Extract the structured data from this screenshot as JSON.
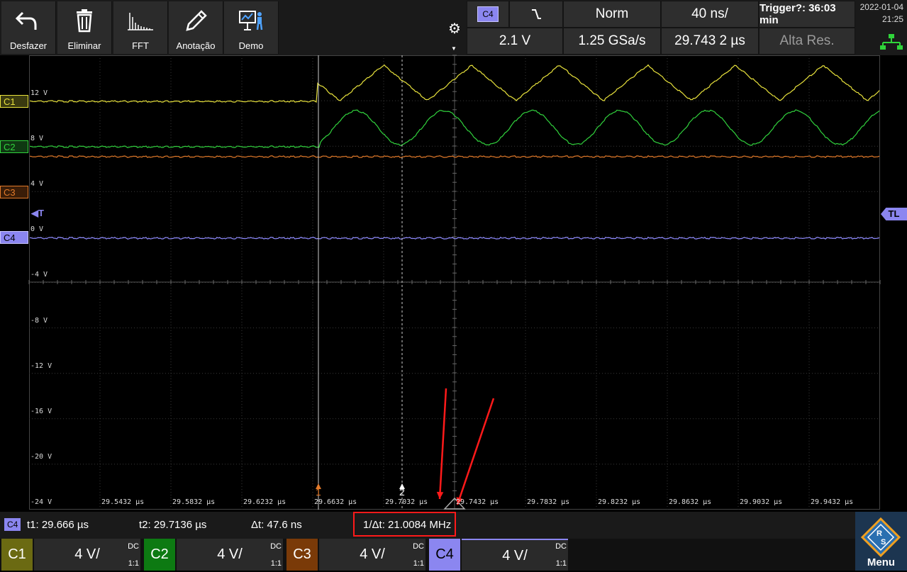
{
  "toolbar": {
    "buttons": [
      {
        "label": "Desfazer",
        "icon": "undo-icon"
      },
      {
        "label": "Eliminar",
        "icon": "trash-icon"
      },
      {
        "label": "FFT",
        "icon": "fft-icon"
      },
      {
        "label": "Anotação",
        "icon": "pencil-icon"
      },
      {
        "label": "Demo",
        "icon": "demo-icon"
      }
    ]
  },
  "trigger": {
    "source": "C4",
    "slope": "falling",
    "mode": "Norm",
    "timebase": "40 ns/",
    "status": "Trigger?: 36:03 min",
    "level": "2.1 V",
    "sample_rate": "1.25 GSa/s",
    "position": "29.743 2 µs",
    "acq_mode": "Alta Res."
  },
  "datetime": {
    "date": "2022-01-04",
    "time": "21:25"
  },
  "graticule": {
    "volt_labels": [
      "12 V",
      "8 V",
      "4 V",
      "0 V",
      "-4 V",
      "-8 V",
      "-12 V",
      "-16 V",
      "-20 V",
      "-24 V"
    ],
    "time_labels": [
      "29.5432 µs",
      "29.5832 µs",
      "29.6232 µs",
      "29.6632 µs",
      "29.7032 µs",
      "29.7432 µs",
      "29.7832 µs",
      "29.8232 µs",
      "29.8632 µs",
      "29.9032 µs",
      "29.9432 µs"
    ],
    "cursor1_label": "1",
    "cursor2_label": "2",
    "trigger_marker": "◀T",
    "trigger_level_marker": "TL"
  },
  "channels_markers": [
    {
      "name": "C1",
      "color": "#d4cf3a"
    },
    {
      "name": "C2",
      "color": "#2fc23a"
    },
    {
      "name": "C3",
      "color": "#d2701e"
    },
    {
      "name": "C4",
      "color": "#8b86f0"
    }
  ],
  "readout": {
    "source": "C4",
    "t1": "t1: 29.666 µs",
    "t2": "t2: 29.7136 µs",
    "dt": "Δt: 47.6 ns",
    "inv_dt": "1/Δt: 21.0084 MHz"
  },
  "channel_bar": [
    {
      "name": "C1",
      "scale": "4 V/",
      "coupling": "DC",
      "ratio": "1:1",
      "color": "#6b6a12"
    },
    {
      "name": "C2",
      "scale": "4 V/",
      "coupling": "DC",
      "ratio": "1:1",
      "color": "#0d7a12"
    },
    {
      "name": "C3",
      "scale": "4 V/",
      "coupling": "DC",
      "ratio": "1:1",
      "color": "#7a3a08"
    },
    {
      "name": "C4",
      "scale": "4 V/",
      "coupling": "DC",
      "ratio": "1:1",
      "color": "#8b86f0"
    }
  ],
  "menu_label": "Menu",
  "colors": {
    "c1": "#e8e23c",
    "c2": "#31d23d",
    "c3": "#e27a2a",
    "c4": "#8f8bff",
    "annotation": "#ff1a1a",
    "accent": "#8b86f0"
  }
}
